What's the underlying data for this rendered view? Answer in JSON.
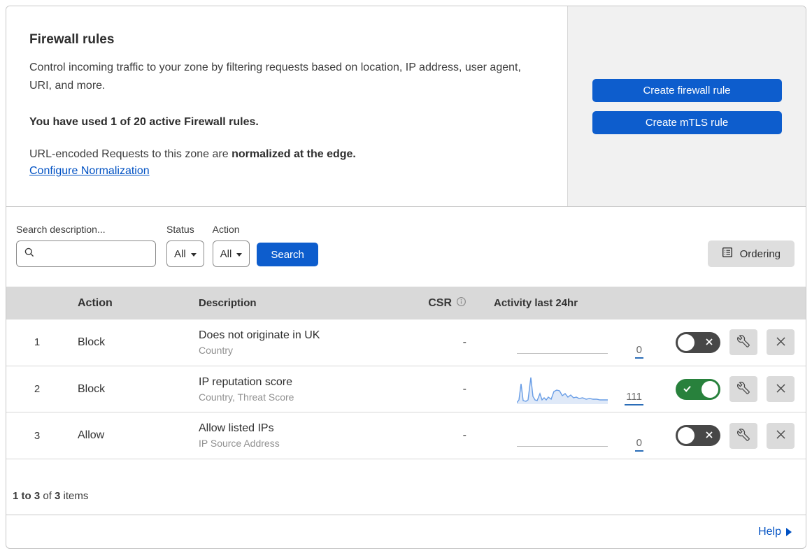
{
  "header": {
    "title": "Firewall rules",
    "description": "Control incoming traffic to your zone by filtering requests based on location, IP address, user agent, URI, and more.",
    "usage_note": "You have used 1 of 20 active Firewall rules.",
    "normalization_text": "URL-encoded Requests to this zone are ",
    "normalization_bold": "normalized at the edge.",
    "normalization_link": "Configure Normalization",
    "buttons": {
      "create_firewall": "Create firewall rule",
      "create_mtls": "Create mTLS rule"
    }
  },
  "filters": {
    "search_label": "Search description...",
    "search_value": "",
    "status_label": "Status",
    "status_value": "All",
    "action_label": "Action",
    "action_value": "All",
    "search_button": "Search",
    "ordering_button": "Ordering"
  },
  "table": {
    "headers": {
      "action": "Action",
      "description": "Description",
      "csr": "CSR",
      "activity": "Activity last 24hr"
    },
    "rows": [
      {
        "num": "1",
        "action": "Block",
        "title": "Does not originate in UK",
        "subtitle": "Country",
        "csr": "-",
        "count": "0",
        "enabled": false
      },
      {
        "num": "2",
        "action": "Block",
        "title": "IP reputation score",
        "subtitle": "Country, Threat Score",
        "csr": "-",
        "count": "111",
        "enabled": true,
        "sparkline": {
          "line": "0,40 3,36 6,13 9,37 13,38 16,36 20,4 23,31 26,36 29,37 33,27 36,36 39,33 42,36 45,32 49,35 53,24 57,22 61,23 65,30 69,27 73,32 77,29 81,33 85,32 89,34 94,33 99,35 104,34 109,35 114,35 119,36 124,36 130,36",
          "fill": "0,40 3,36 6,13 9,37 13,38 16,36 20,4 23,31 26,36 29,37 33,27 36,36 39,33 42,36 45,32 49,35 53,24 57,22 61,23 65,30 69,27 73,32 77,29 81,33 85,32 89,34 94,33 99,35 104,34 109,35 114,35 119,36 124,36 130,36 130,42 0,42"
        }
      },
      {
        "num": "3",
        "action": "Allow",
        "title": "Allow listed IPs",
        "subtitle": "IP Source Address",
        "csr": "-",
        "count": "0",
        "enabled": false
      }
    ],
    "summary": {
      "range": "1 to 3",
      "of": " of ",
      "total": "3",
      "items": " items"
    }
  },
  "footer": {
    "help": "Help"
  },
  "icons": {
    "search": "magnifier",
    "info": "circled-i",
    "ordering": "list-in-box",
    "wrench": "spanner",
    "delete": "x-cross",
    "toggle_off": "x-in-pill",
    "toggle_on": "check-in-pill",
    "help_arrow": "right-triangle"
  },
  "colors": {
    "primary_button": "#0d5dcd",
    "link": "#0051c3",
    "toggle_on": "#28813c",
    "toggle_off": "#474747",
    "sparkline_line": "#689de6",
    "sparkline_fill": "#dfe9f8",
    "table_header_bg": "#d9d9d9",
    "panel_bg": "#f1f1f1"
  }
}
